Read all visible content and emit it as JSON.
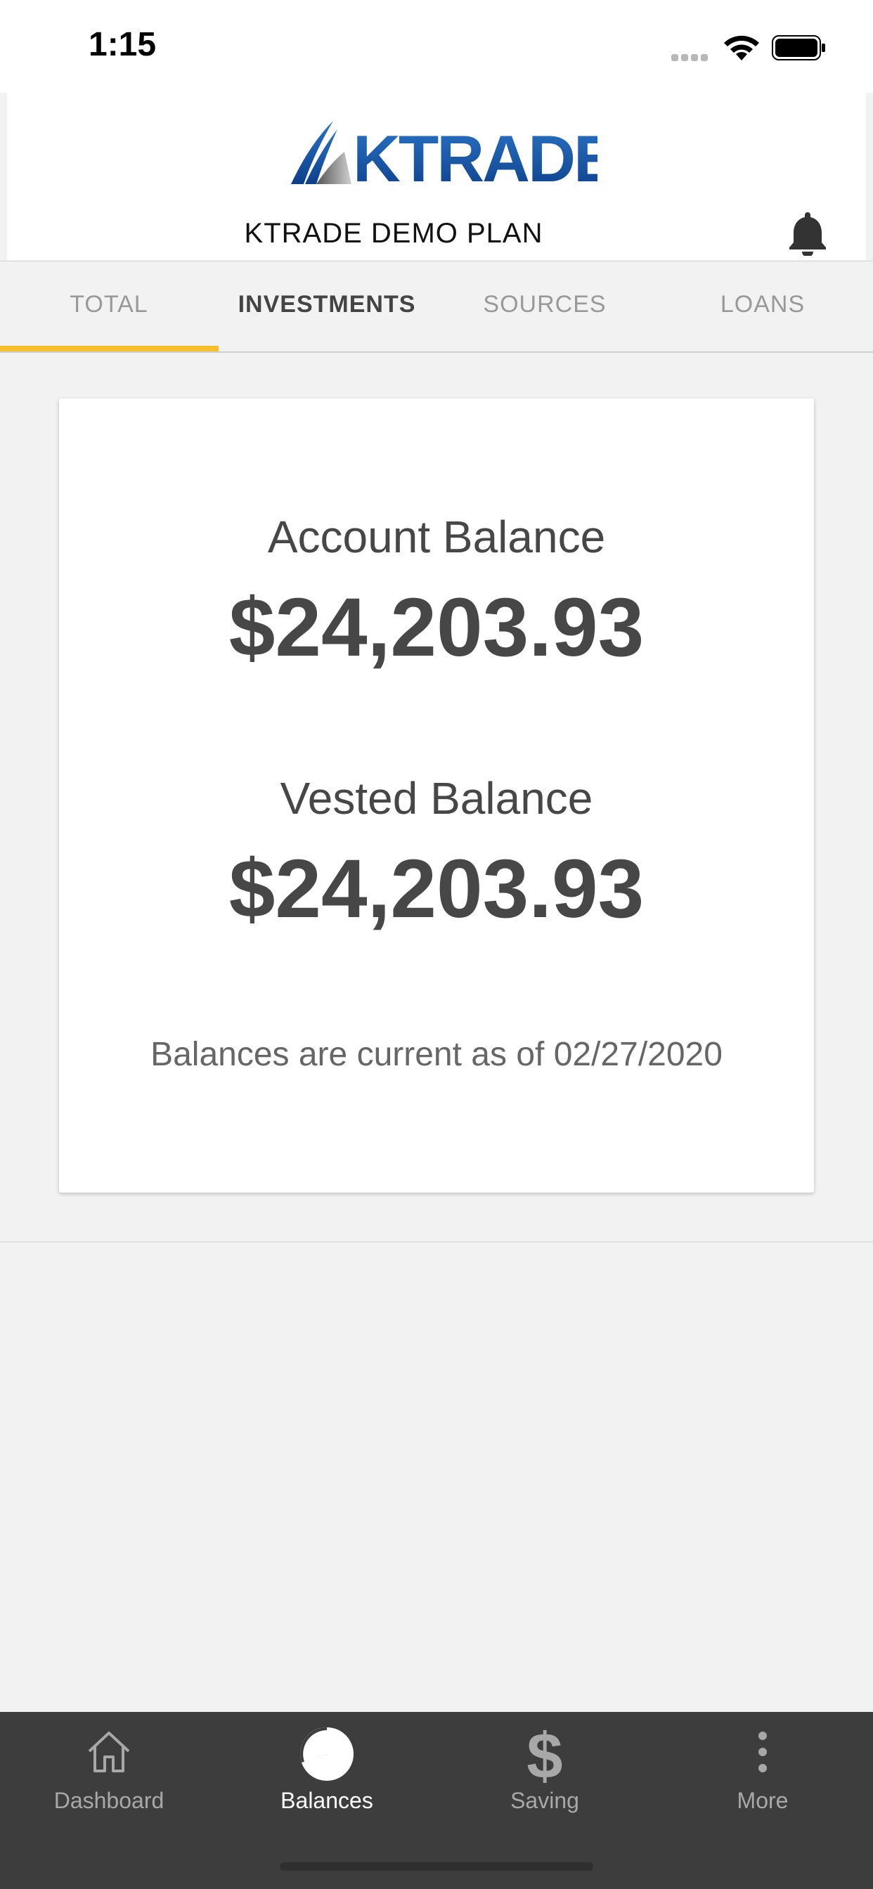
{
  "status_bar": {
    "time": "1:15"
  },
  "header": {
    "logo_text": "KTRADE",
    "plan_name": "KTRADE DEMO PLAN"
  },
  "tabs": [
    {
      "label": "TOTAL"
    },
    {
      "label": "INVESTMENTS"
    },
    {
      "label": "SOURCES"
    },
    {
      "label": "LOANS"
    }
  ],
  "active_tab": "TOTAL",
  "card": {
    "account_balance_label": "Account Balance",
    "account_balance_value": "$24,203.93",
    "vested_balance_label": "Vested Balance",
    "vested_balance_value": "$24,203.93",
    "as_of_note": "Balances are current as of 02/27/2020"
  },
  "bottom_nav": [
    {
      "label": "Dashboard",
      "icon": "home-icon"
    },
    {
      "label": "Balances",
      "icon": "pie-chart-icon"
    },
    {
      "label": "Saving",
      "icon": "dollar-icon"
    },
    {
      "label": "More",
      "icon": "more-vertical-icon"
    }
  ],
  "colors": {
    "accent": "#f5bf2a",
    "brand_blue": "#1b5fae",
    "nav_background": "#3d3d3d"
  }
}
